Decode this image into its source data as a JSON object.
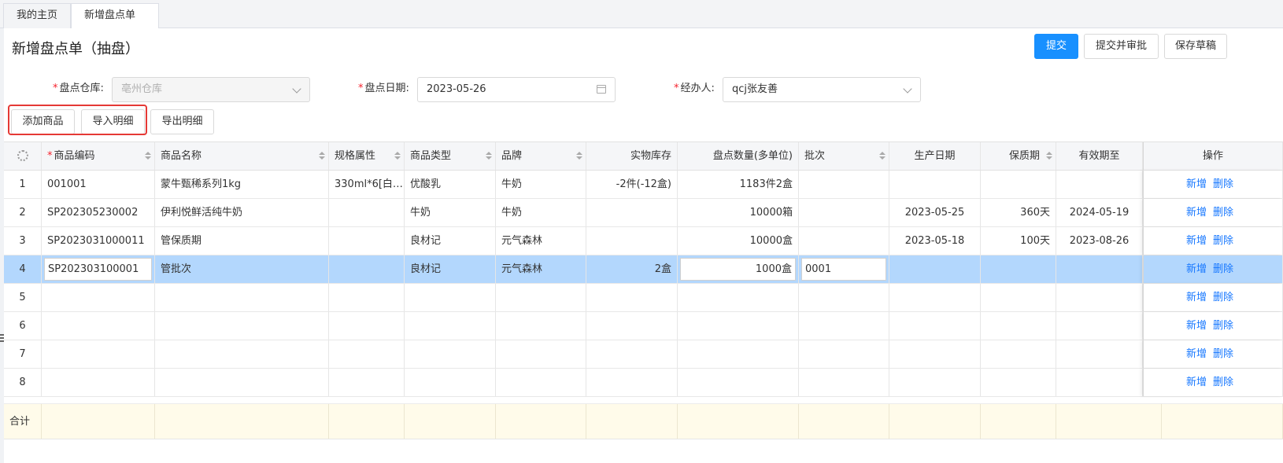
{
  "tabs": [
    {
      "label": "我的主页"
    },
    {
      "label": "新增盘点单"
    }
  ],
  "page": {
    "title": "新增盘点单（抽盘）",
    "actions": {
      "submit": "提交",
      "submit_approve": "提交并审批",
      "save_draft": "保存草稿"
    }
  },
  "form": {
    "warehouse": {
      "label": "盘点仓库:",
      "value": "亳州仓库"
    },
    "date": {
      "label": "盘点日期:",
      "value": "2023-05-26"
    },
    "handler": {
      "label": "经办人:",
      "value": "qcj张友善"
    }
  },
  "toolbar": {
    "add": "添加商品",
    "import": "导入明细",
    "export": "导出明细"
  },
  "table": {
    "headers": {
      "code": "商品编码",
      "name": "商品名称",
      "spec": "规格属性",
      "type": "商品类型",
      "brand": "品牌",
      "stock": "实物库存",
      "qty": "盘点数量(多单位)",
      "batch": "批次",
      "prod_date": "生产日期",
      "shelf": "保质期",
      "expire": "有效期至",
      "ops": "操作"
    },
    "rows": [
      {
        "no": "1",
        "code": "001001",
        "name": "蒙牛甄稀系列1kg",
        "spec": "330ml*6[白…",
        "type": "优酸乳",
        "brand": "牛奶",
        "stock": "-2件(-12盒)",
        "qty": "1183件2盒",
        "batch": "",
        "prod_date": "",
        "shelf": "",
        "expire": ""
      },
      {
        "no": "2",
        "code": "SP202305230002",
        "name": "伊利悦鲜活纯牛奶",
        "spec": "",
        "type": "牛奶",
        "brand": "牛奶",
        "stock": "",
        "qty": "10000箱",
        "batch": "",
        "prod_date": "2023-05-25",
        "shelf": "360天",
        "expire": "2024-05-19"
      },
      {
        "no": "3",
        "code": "SP2023031000011",
        "name": "管保质期",
        "spec": "",
        "type": "良材记",
        "brand": "元气森林",
        "stock": "",
        "qty": "10000盒",
        "batch": "",
        "prod_date": "2023-05-18",
        "shelf": "100天",
        "expire": "2023-08-26"
      },
      {
        "no": "4",
        "code": "SP202303100001",
        "name": "管批次",
        "spec": "",
        "type": "良材记",
        "brand": "元气森林",
        "stock": "2盒",
        "qty": "1000盒",
        "batch": "0001",
        "prod_date": "",
        "shelf": "",
        "expire": ""
      },
      {
        "no": "5",
        "code": "",
        "name": "",
        "spec": "",
        "type": "",
        "brand": "",
        "stock": "",
        "qty": "",
        "batch": "",
        "prod_date": "",
        "shelf": "",
        "expire": ""
      },
      {
        "no": "6",
        "code": "",
        "name": "",
        "spec": "",
        "type": "",
        "brand": "",
        "stock": "",
        "qty": "",
        "batch": "",
        "prod_date": "",
        "shelf": "",
        "expire": ""
      },
      {
        "no": "7",
        "code": "",
        "name": "",
        "spec": "",
        "type": "",
        "brand": "",
        "stock": "",
        "qty": "",
        "batch": "",
        "prod_date": "",
        "shelf": "",
        "expire": ""
      },
      {
        "no": "8",
        "code": "",
        "name": "",
        "spec": "",
        "type": "",
        "brand": "",
        "stock": "",
        "qty": "",
        "batch": "",
        "prod_date": "",
        "shelf": "",
        "expire": ""
      }
    ],
    "row_actions": {
      "add": "新增",
      "delete": "删除"
    },
    "footer_label": "合计"
  },
  "colors": {
    "primary": "#1890ff",
    "selected_row": "#b3d7fd",
    "footer_bg": "#fffbea",
    "required": "#f5222d",
    "highlight": "#e53935"
  }
}
